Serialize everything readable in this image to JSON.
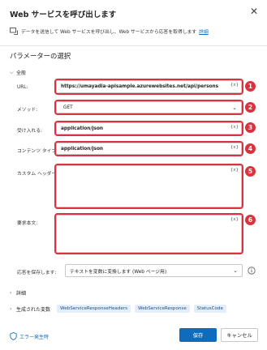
{
  "dialog": {
    "title": "Web サービスを呼び出します"
  },
  "description": {
    "text": "データを送信して Web サービスを呼び出し、Web サービスから応答を取得します",
    "link": "詳細"
  },
  "section_title": "パラメーターの選択",
  "groups": {
    "general": "全般",
    "details": "詳細",
    "generated": "生成された変数"
  },
  "fields": {
    "url": {
      "label": "URL:",
      "value": "https://umayadia-apisample.azurewebsites.net/api/persons"
    },
    "method": {
      "label": "メソッド:",
      "value": "GET"
    },
    "accept": {
      "label": "受け入れる:",
      "value": "application/json"
    },
    "content_type": {
      "label": "コンテンツ タイプ:",
      "value": "application/json"
    },
    "custom_headers": {
      "label": "カスタム ヘッダー:",
      "value": ""
    },
    "request_body": {
      "label": "要求本文:",
      "value": ""
    },
    "save_response": {
      "label": "応答を保存します:",
      "value": "テキストを変数に変換します (Web ページ用)"
    }
  },
  "fx_symbol": "{x}",
  "badges": [
    "1",
    "2",
    "3",
    "4",
    "5",
    "6"
  ],
  "variables": [
    "WebServiceResponseHeaders",
    "WebServiceResponse",
    "StatusCode"
  ],
  "footer": {
    "on_error": "エラー発生時",
    "save": "保存",
    "cancel": "キャンセル"
  },
  "colors": {
    "accent": "#0f6cbd",
    "highlight": "#d9333f",
    "chip_bg": "#e4eef8"
  }
}
